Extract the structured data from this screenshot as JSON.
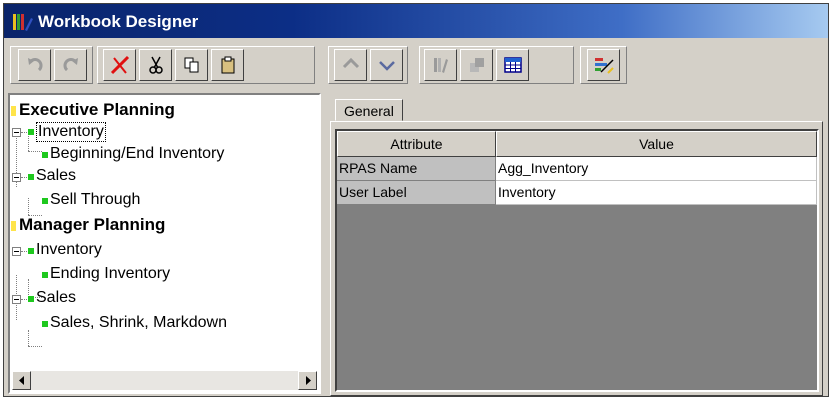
{
  "window": {
    "title": "Workbook Designer"
  },
  "toolbar": {
    "icons": [
      "undo-icon",
      "redo-icon",
      "delete-icon",
      "cut-icon",
      "copy-icon",
      "paste-icon",
      "move-up-icon",
      "move-down-icon",
      "books-icon",
      "workbook-icon",
      "table-icon",
      "chart-wizard-icon"
    ]
  },
  "tree": {
    "root1": "Executive Planning",
    "root1_inventory": "Inventory",
    "root1_inventory_child": "Beginning/End Inventory",
    "root1_sales": "Sales",
    "root1_sales_child": "Sell Through",
    "root2": "Manager Planning",
    "root2_inventory": "Inventory",
    "root2_inventory_child": "Ending Inventory",
    "root2_sales": "Sales",
    "root2_sales_child": "Sales, Shrink, Markdown"
  },
  "properties": {
    "tab_label": "General",
    "columns": [
      "Attribute",
      "Value"
    ],
    "rows": [
      {
        "attribute": "RPAS Name",
        "value": "Agg_Inventory"
      },
      {
        "attribute": "User Label",
        "value": "Inventory"
      }
    ]
  },
  "colors": {
    "title_bar": "#0a246a",
    "node_green": "#1ec81e",
    "root_marker": "#ffe44a",
    "window_face": "#d4d0c8"
  }
}
